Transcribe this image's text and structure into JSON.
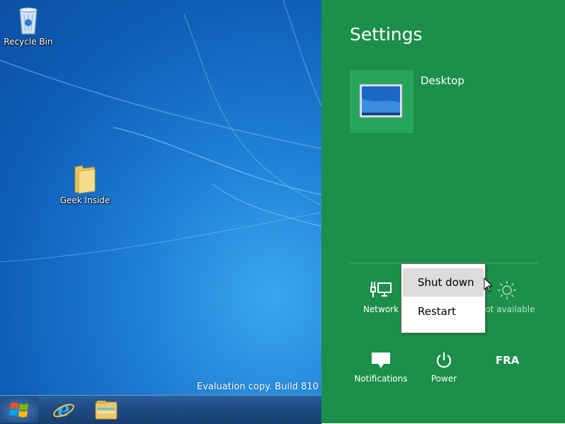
{
  "desktop": {
    "icons": [
      {
        "label": "Recycle Bin"
      },
      {
        "label": "Geek Inside"
      }
    ],
    "watermark": "Evaluation copy. Build 810"
  },
  "taskbar": {
    "items": [
      "start-orb",
      "internet-explorer",
      "file-explorer"
    ]
  },
  "settings": {
    "title": "Settings",
    "tile_label": "Desktop",
    "quick_settings": [
      {
        "label": "Network",
        "icon": "network-icon"
      },
      {
        "label": "Not available",
        "icon": "brightness-icon"
      },
      {
        "label": "Notifications",
        "icon": "notifications-icon"
      },
      {
        "label": "Power",
        "icon": "power-icon"
      },
      {
        "label": "FRA",
        "icon": "keyboard-language"
      }
    ]
  },
  "power_menu": {
    "items": [
      {
        "label": "Shut down",
        "highlighted": true
      },
      {
        "label": "Restart",
        "highlighted": false
      }
    ]
  },
  "colors": {
    "charm_bg": "#1c8f4a",
    "tile_bg": "#27a55a",
    "desktop_bg": "#1f7fd6"
  }
}
